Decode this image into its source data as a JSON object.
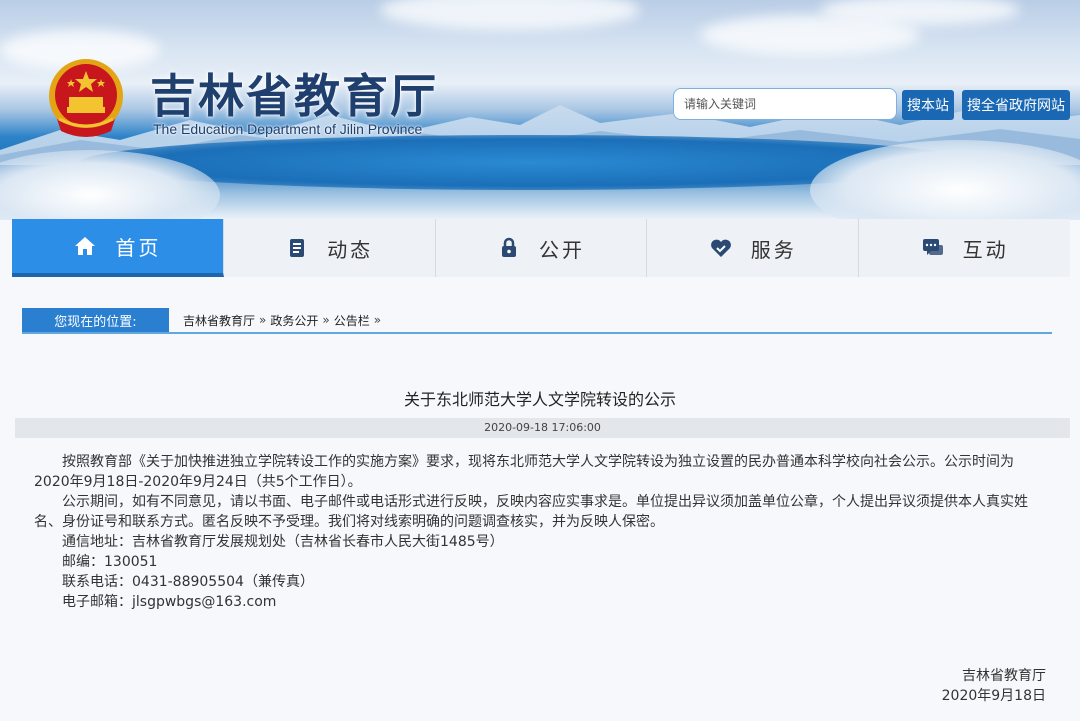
{
  "header": {
    "title": "吉林省教育厅",
    "subtitle": "The Education Department of Jilin Province",
    "search_placeholder": "请输入关键词",
    "search_site_label": "搜本站",
    "search_gov_label": "搜全省政府网站"
  },
  "nav": {
    "items": [
      {
        "label": "首页",
        "icon": "home-icon",
        "active": true
      },
      {
        "label": "动态",
        "icon": "document-icon",
        "active": false
      },
      {
        "label": "公开",
        "icon": "lock-icon",
        "active": false
      },
      {
        "label": "服务",
        "icon": "handshake-heart-icon",
        "active": false
      },
      {
        "label": "互动",
        "icon": "chat-icon",
        "active": false
      }
    ]
  },
  "breadcrumb": {
    "label": "您现在的位置:",
    "items": [
      "吉林省教育厅",
      "政务公开",
      "公告栏"
    ],
    "separator": "»"
  },
  "article": {
    "title": "关于东北师范大学人文学院转设的公示",
    "date": "2020-09-18 17:06:00",
    "para1": "按照教育部《关于加快推进独立学院转设工作的实施方案》要求，现将东北师范大学人文学院转设为独立设置的民办普通本科学校向社会公示。公示时间为2020年9月18日-2020年9月24日（共5个工作日）。",
    "para2": "公示期间，如有不同意见，请以书面、电子邮件或电话形式进行反映，反映内容应实事求是。单位提出异议须加盖单位公章，个人提出异议须提供本人真实姓名、身份证号和联系方式。匿名反映不予受理。我们将对线索明确的问题调查核实，并为反映人保密。",
    "address": "通信地址：吉林省教育厅发展规划处（吉林省长春市人民大街1485号）",
    "postcode": "邮编：130051",
    "phone": "联系电话：0431-88905504（兼传真）",
    "email": "电子邮箱：jlsgpwbgs@163.com",
    "sign_org": "吉林省教育厅",
    "sign_date": "2020年9月18日"
  },
  "colors": {
    "nav_active": "#2d8ee8",
    "button": "#1a68b4",
    "title": "#1f3f6e",
    "crumb_label": "#2a7fd0"
  }
}
